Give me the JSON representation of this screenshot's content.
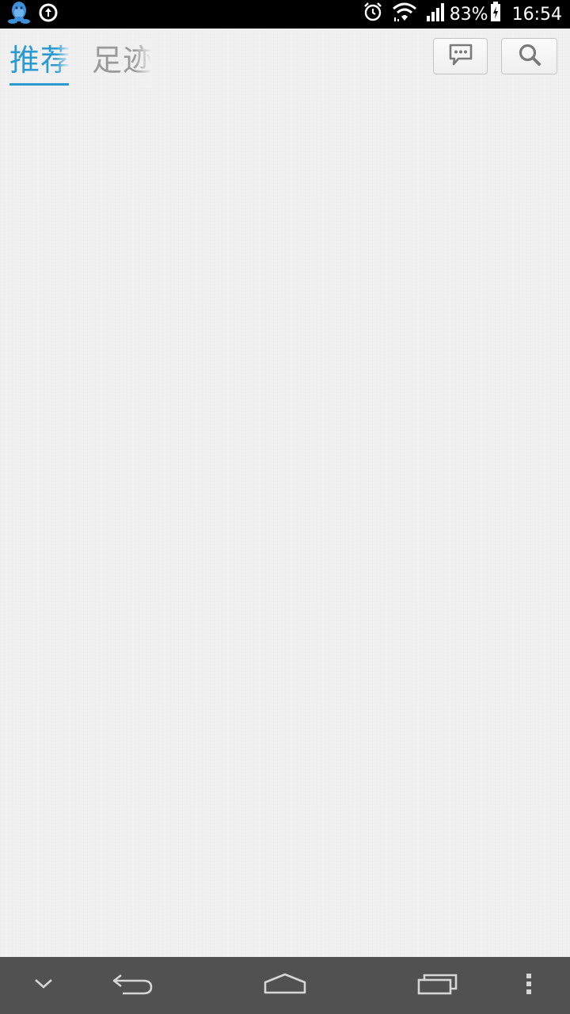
{
  "status_bar": {
    "battery_percent": "83%",
    "time": "16:54",
    "icons": [
      "qq-icon",
      "sync-icon",
      "alarm-icon",
      "wifi-icon",
      "signal-icon",
      "battery-charging-icon"
    ]
  },
  "top_bar": {
    "tabs": [
      {
        "label": "推荐",
        "selected": true
      },
      {
        "label": "足迹",
        "selected": false
      }
    ],
    "buttons": [
      {
        "icon": "message-icon"
      },
      {
        "icon": "search-icon"
      }
    ]
  },
  "nav_bar": {
    "buttons": [
      "hide-keyboard-icon",
      "back-icon",
      "home-icon",
      "recent-apps-icon",
      "overflow-menu-icon"
    ]
  },
  "colors": {
    "accent": "#2a9ad1",
    "inactive_tab": "#9a9a9a",
    "background": "#f1f1f1",
    "status_bar": "#000000",
    "nav_bar": "#515151"
  }
}
